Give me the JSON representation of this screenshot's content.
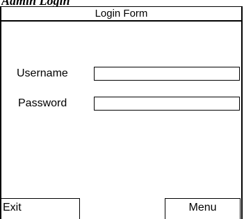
{
  "page": {
    "title": "Admin Login"
  },
  "form": {
    "title": "Login Form",
    "username_label": "Username",
    "username_value": "",
    "password_label": "Password",
    "password_value": ""
  },
  "softkeys": {
    "left_label": "Exit",
    "right_label": "Menu"
  }
}
